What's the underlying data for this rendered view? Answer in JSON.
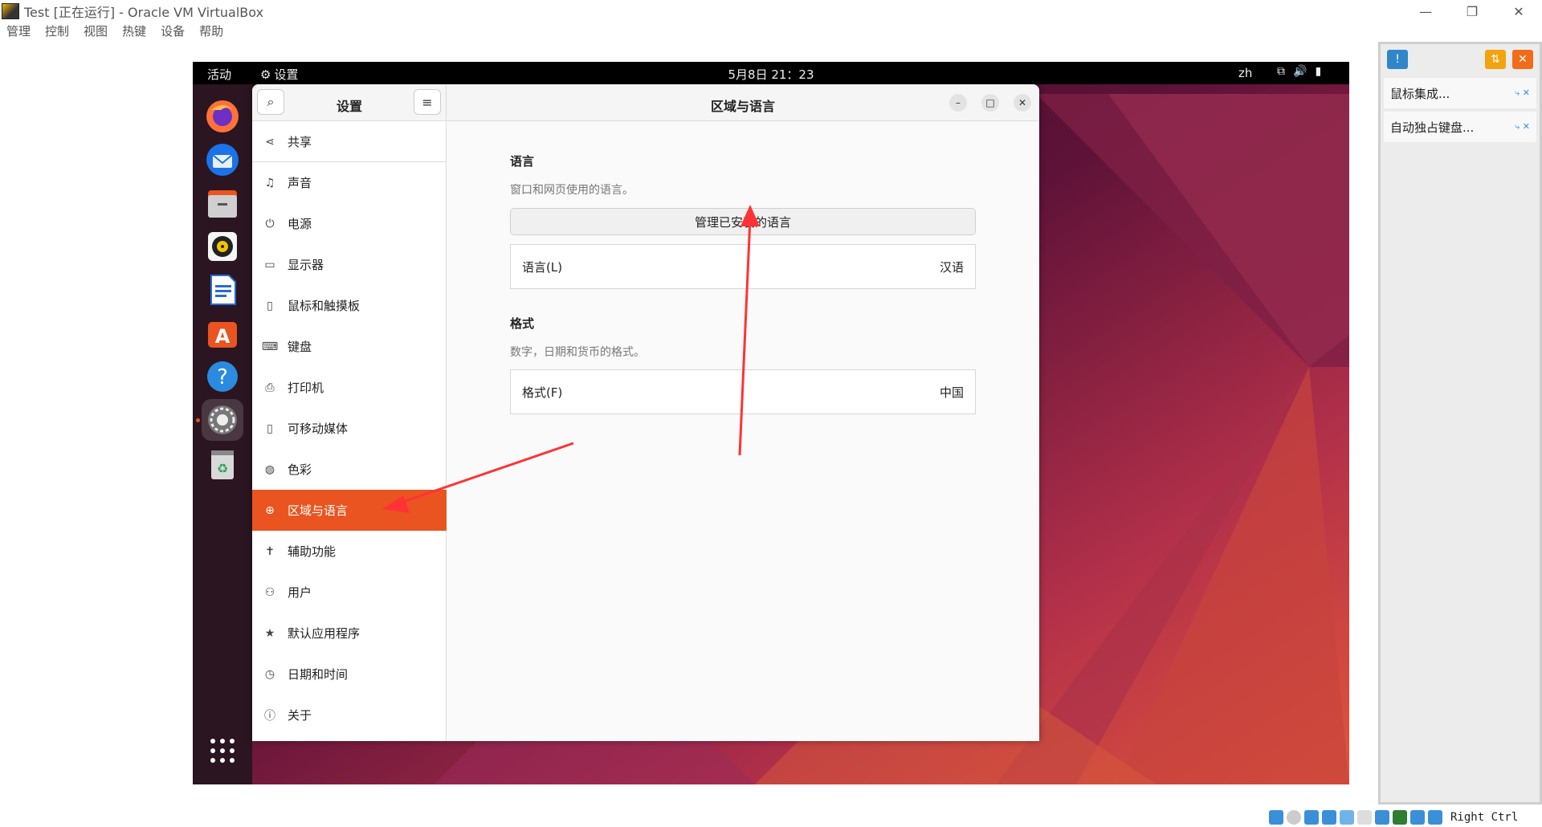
{
  "host": {
    "title": "Test [正在运行] - Oracle VM VirtualBox",
    "menu": [
      "管理",
      "控制",
      "视图",
      "热键",
      "设备",
      "帮助"
    ],
    "right_panel": {
      "notes": [
        "鼠标集成...",
        "自动独占键盘..."
      ]
    },
    "status_key": "Right Ctrl"
  },
  "topbar": {
    "activities": "活动",
    "app": "设置",
    "clock": "5月8日  21：23",
    "lang": "zh"
  },
  "dock": {
    "items": [
      "firefox-icon",
      "thunderbird-icon",
      "files-icon",
      "rhythmbox-icon",
      "writer-icon",
      "app-center-icon",
      "help-icon",
      "settings-icon",
      "trash-icon",
      "app-grid-icon"
    ]
  },
  "settings": {
    "sidebar_title": "设置",
    "main_title": "区域与语言",
    "items": [
      {
        "label": "共享",
        "icon": "share-icon"
      },
      {
        "label": "声音",
        "icon": "music-note-icon"
      },
      {
        "label": "电源",
        "icon": "power-icon"
      },
      {
        "label": "显示器",
        "icon": "display-icon"
      },
      {
        "label": "鼠标和触摸板",
        "icon": "mouse-icon"
      },
      {
        "label": "键盘",
        "icon": "keyboard-icon"
      },
      {
        "label": "打印机",
        "icon": "printer-icon"
      },
      {
        "label": "可移动媒体",
        "icon": "usb-icon"
      },
      {
        "label": "色彩",
        "icon": "color-icon"
      },
      {
        "label": "区域与语言",
        "icon": "globe-icon",
        "active": true
      },
      {
        "label": "辅助功能",
        "icon": "accessibility-icon"
      },
      {
        "label": "用户",
        "icon": "user-icon"
      },
      {
        "label": "默认应用程序",
        "icon": "star-icon"
      },
      {
        "label": "日期和时间",
        "icon": "clock-icon"
      },
      {
        "label": "关于",
        "icon": "info-icon"
      }
    ],
    "language": {
      "title": "语言",
      "desc": "窗口和网页使用的语言。",
      "manage_button": "管理已安装的语言",
      "row_label": "语言(L)",
      "row_value": "汉语"
    },
    "formats": {
      "title": "格式",
      "desc": "数字，日期和货币的格式。",
      "row_label": "格式(F)",
      "row_value": "中国"
    }
  },
  "colors": {
    "accent": "#e95420"
  }
}
